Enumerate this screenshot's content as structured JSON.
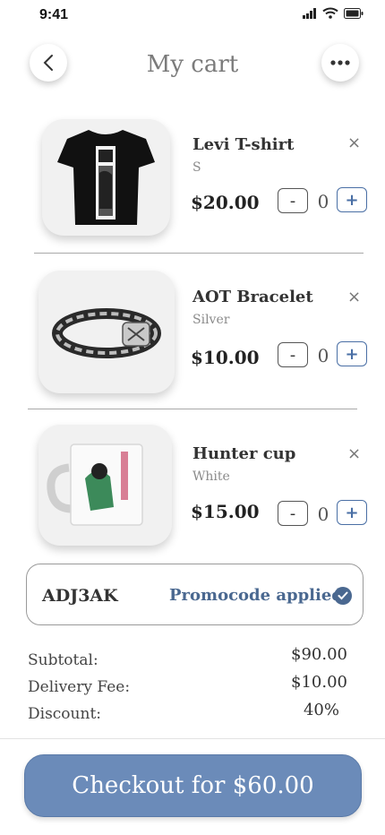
{
  "status_bar": {
    "time": "9:41"
  },
  "header": {
    "title": "My cart"
  },
  "items": [
    {
      "name": "Levi T-shirt",
      "variant": "S",
      "price": "$20.00",
      "quantity": "0",
      "image_icon": "black-tshirt-icon"
    },
    {
      "name": "AOT Bracelet",
      "variant": "Silver",
      "price": "$10.00",
      "quantity": "0",
      "image_icon": "bracelet-icon"
    },
    {
      "name": "Hunter cup",
      "variant": "White",
      "price": "$15.00",
      "quantity": "0",
      "image_icon": "mug-icon"
    }
  ],
  "controls": {
    "remove": "×",
    "minus": "-",
    "plus": "+"
  },
  "promo": {
    "code": "ADJ3AK",
    "status": "Promocode applied"
  },
  "summary": {
    "subtotal_label": "Subtotal:",
    "subtotal_value": "$90.00",
    "delivery_label": "Delivery Fee:",
    "delivery_value": "$10.00",
    "discount_label": "Discount:",
    "discount_value": "40%"
  },
  "checkout": {
    "label": "Checkout for $60.00"
  },
  "colors": {
    "accent": "#4a6fa5",
    "checkout": "#6b8bb9",
    "promo_text": "#4a6890"
  }
}
